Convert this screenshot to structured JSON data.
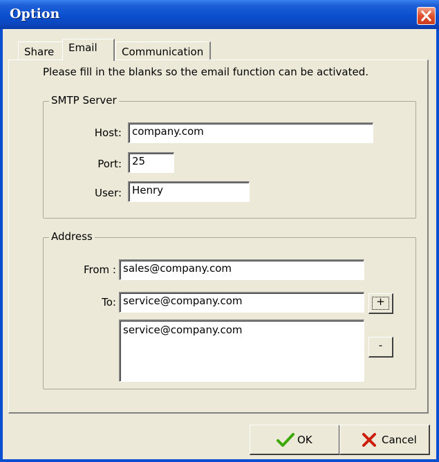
{
  "window": {
    "title": "Option"
  },
  "tabs": [
    {
      "label": "Share"
    },
    {
      "label": "Email",
      "active": true
    },
    {
      "label": "Communication"
    }
  ],
  "intro_text": "Please fill in the blanks so the email function can be activated.",
  "smtp": {
    "group_label": "SMTP Server",
    "host_label": "Host:",
    "host_value": "company.com",
    "port_label": "Port:",
    "port_value": "25",
    "user_label": "User:",
    "user_value": "Henry"
  },
  "address": {
    "group_label": "Address",
    "from_label": "From :",
    "from_value": "sales@company.com",
    "to_label": "To:",
    "to_value": "service@company.com",
    "add_label": "+",
    "remove_label": "-",
    "recipients": [
      "service@company.com"
    ]
  },
  "buttons": {
    "ok_label": "OK",
    "cancel_label": "Cancel"
  },
  "colors": {
    "titlebar": "#0a4fcf",
    "ok_check": "#3aa800",
    "cancel_x": "#cc1d0e",
    "close": "#e0502e"
  },
  "icons": {
    "close": "close-icon",
    "ok": "checkmark-icon",
    "cancel": "x-icon"
  }
}
